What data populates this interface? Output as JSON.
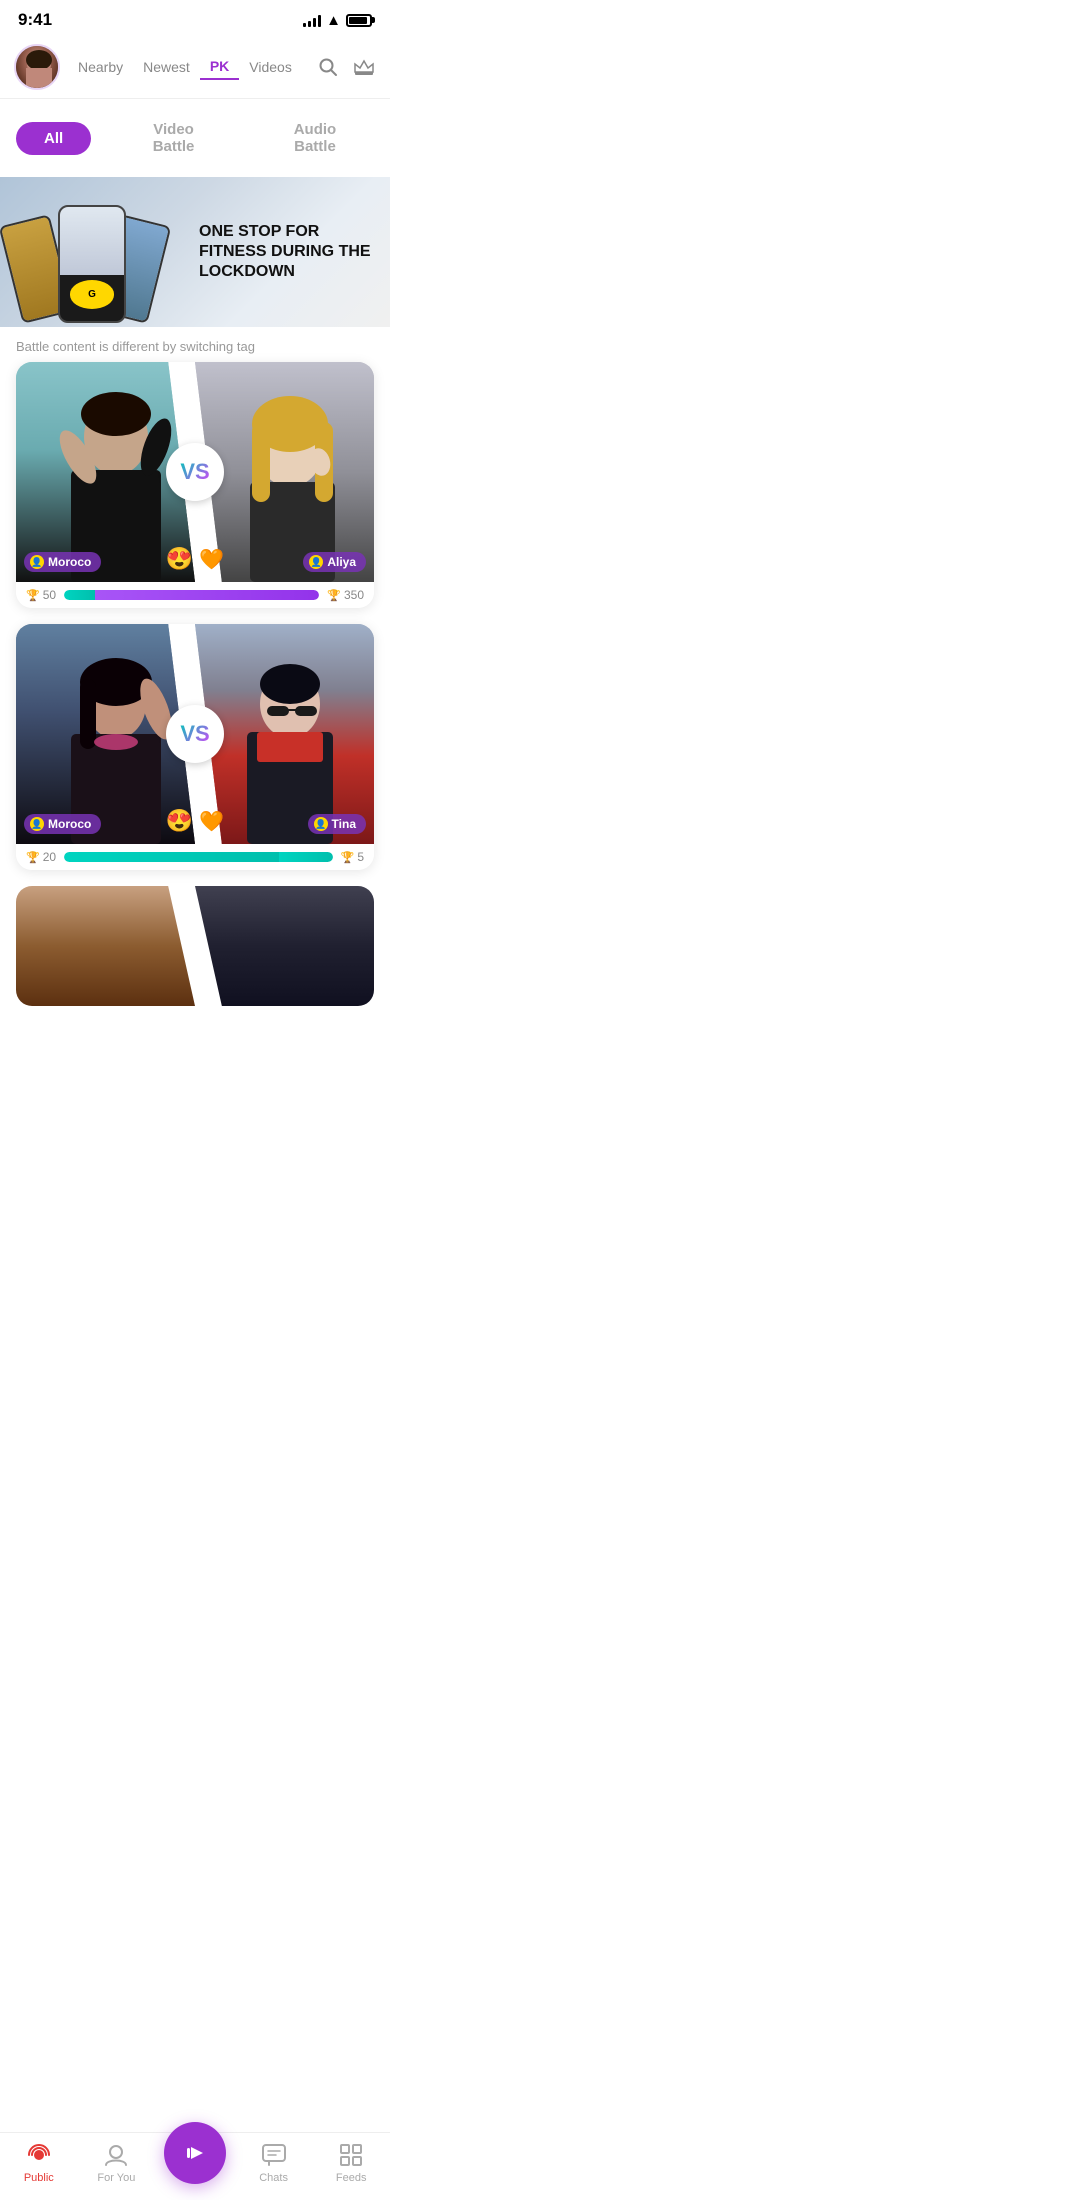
{
  "statusBar": {
    "time": "9:41"
  },
  "header": {
    "tabs": [
      {
        "id": "nearby",
        "label": "Nearby",
        "active": false
      },
      {
        "id": "newest",
        "label": "Newest",
        "active": false
      },
      {
        "id": "pk",
        "label": "PK",
        "active": true
      },
      {
        "id": "videos",
        "label": "Videos",
        "active": false
      }
    ]
  },
  "filters": {
    "all": "All",
    "videoBattle": "Video Battle",
    "audioBattle": "Audio Battle"
  },
  "banner": {
    "text": "ONE STOP FOR FITNESS DURING THE LOCKDOWN"
  },
  "subtitle": "Battle content is different by switching tag",
  "battleCards": [
    {
      "id": 1,
      "leftUser": "Moroco",
      "rightUser": "Aliya",
      "leftScore": 50,
      "rightScore": 350,
      "leftPercent": 12,
      "rightPercent": 88
    },
    {
      "id": 2,
      "leftUser": "Moroco",
      "rightUser": "Tina",
      "leftScore": 20,
      "rightScore": 5,
      "leftPercent": 80,
      "rightPercent": 20
    }
  ],
  "bottomNav": {
    "items": [
      {
        "id": "public",
        "label": "Public",
        "active": true
      },
      {
        "id": "foryou",
        "label": "For You",
        "active": false
      },
      {
        "id": "golive",
        "label": "Go Live",
        "active": false
      },
      {
        "id": "chats",
        "label": "Chats",
        "active": false
      },
      {
        "id": "feeds",
        "label": "Feeds",
        "active": false
      }
    ]
  }
}
